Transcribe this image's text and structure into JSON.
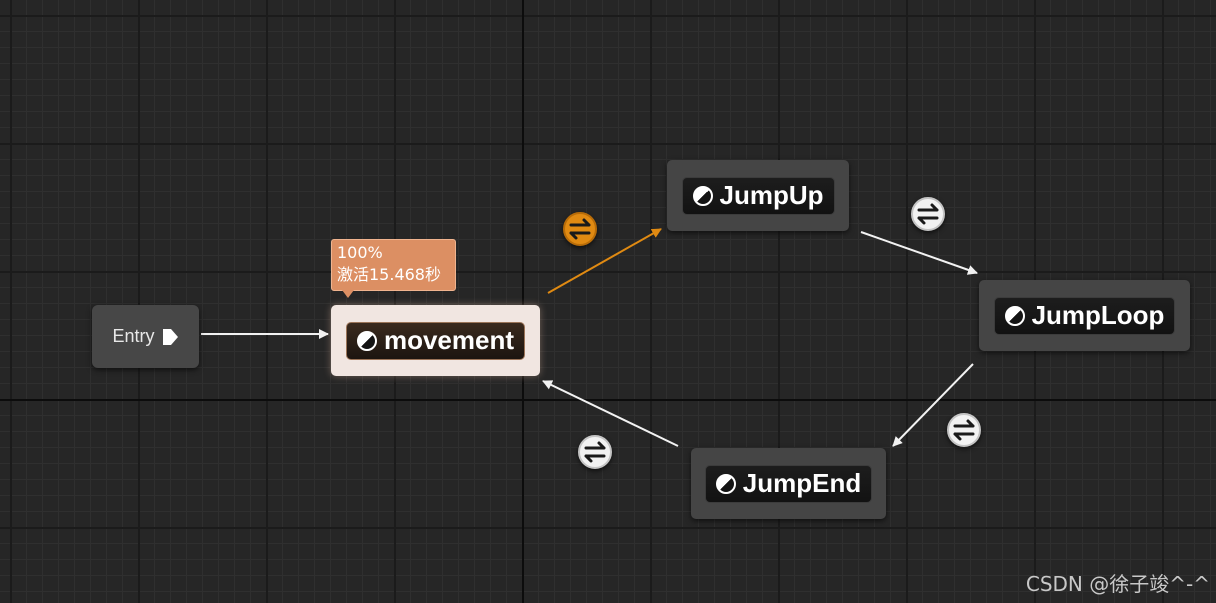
{
  "graph": {
    "entry": {
      "label": "Entry"
    },
    "states": {
      "movement": {
        "label": "movement",
        "active": true
      },
      "jump_up": {
        "label": "JumpUp"
      },
      "jump_loop": {
        "label": "JumpLoop"
      },
      "jump_end": {
        "label": "JumpEnd"
      }
    },
    "active_tooltip": {
      "weight": "100%",
      "activation": "激活15.468秒"
    },
    "transitions": [
      {
        "from": "movement",
        "to": "JumpUp",
        "active": true
      },
      {
        "from": "JumpUp",
        "to": "JumpLoop",
        "active": false
      },
      {
        "from": "JumpLoop",
        "to": "JumpEnd",
        "active": false
      },
      {
        "from": "JumpEnd",
        "to": "movement",
        "active": false
      }
    ]
  },
  "colors": {
    "background": "#262626",
    "active_transition": "#e08a12",
    "tooltip": "#dc8f63",
    "active_node": "#f1e6e1"
  },
  "watermark": "CSDN @徐子竣^-^"
}
